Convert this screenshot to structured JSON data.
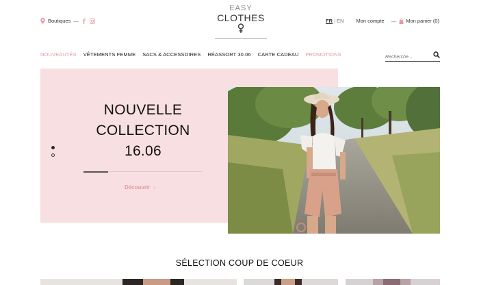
{
  "header": {
    "boutiques_label": "Boutiques",
    "logo_top": "EASY",
    "logo_main": "CLOTHES",
    "lang_fr": "FR",
    "lang_sep": "|",
    "lang_en": "EN",
    "account_label": "Mon compte",
    "account_sep": "—",
    "cart_label": "Mon panier (0)"
  },
  "nav": {
    "items": [
      {
        "label": "NOUVEAUTÉS"
      },
      {
        "label": "VÊTEMENTS FEMME"
      },
      {
        "label": "SACS & ACCESSOIRES"
      },
      {
        "label": "RÉASSORT 30.06"
      },
      {
        "label": "CARTE CADEAU"
      },
      {
        "label": "PROMOTIONS"
      }
    ],
    "highlight_color": "#e49aa3"
  },
  "search": {
    "placeholder": "Recherche..."
  },
  "hero": {
    "title_line1": "NOUVELLE",
    "title_line2": "COLLECTION",
    "title_line3": "16.06",
    "cta_label": "Découvrir",
    "cta_arrow": "›",
    "background_color": "#f8dfe1",
    "slide_index": 1,
    "slide_count": 2
  },
  "section": {
    "title": "SÉLECTION COUP DE COEUR"
  }
}
